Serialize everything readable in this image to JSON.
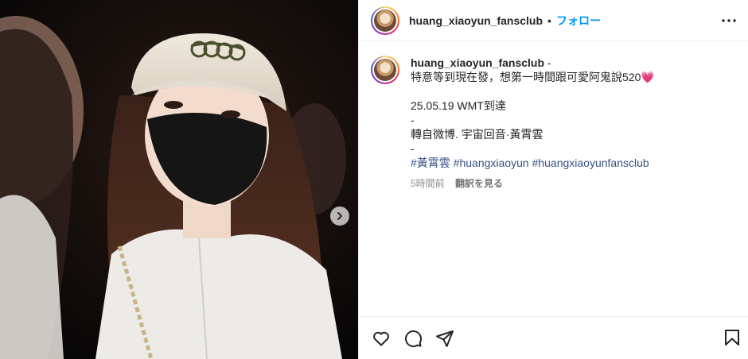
{
  "post": {
    "username": "huang_xiaoyun_fansclub",
    "separator": "•",
    "follow_label": "フォロー"
  },
  "caption": {
    "username": "huang_xiaoyun_fansclub",
    "after_username": " -",
    "line1": "特意等到現在發，想第一時間跟可愛阿鬼說520",
    "heart": "💗",
    "line3": "25.05.19 WMT到達",
    "dash1": "-",
    "line5": "轉自微博. 宇宙回音·黃霄雲",
    "dash2": "-",
    "hashtags": [
      "#黃霄雲",
      "#huangxiaoyun",
      "#huangxiaoyunfansclub"
    ]
  },
  "meta": {
    "time": "5時間前",
    "translate": "翻訳を見る"
  },
  "icons": {
    "more": "more-options-icon",
    "next": "chevron-right-icon",
    "like": "heart-icon",
    "comment": "comment-icon",
    "share": "share-icon",
    "save": "bookmark-icon"
  },
  "colors": {
    "follow": "#0095f6",
    "hashtag": "#385185",
    "meta": "#8e8e8e"
  }
}
